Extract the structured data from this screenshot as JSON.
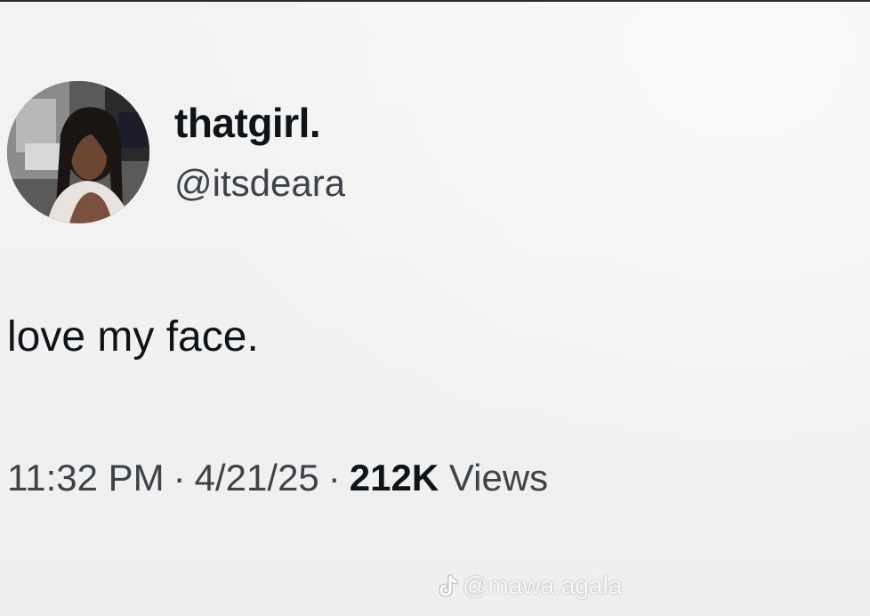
{
  "tweet": {
    "display_name": "thatgirl.",
    "handle": "@itsdeara",
    "text": "love my face.",
    "time": "11:32 PM",
    "date": "4/21/25",
    "separator": "·",
    "view_count": "212K",
    "views_label": "Views"
  },
  "watermark": {
    "icon": "tiktok-icon",
    "handle": "@mawa.agala"
  },
  "colors": {
    "background": "#f1f1f1",
    "primary_text": "#0f1419",
    "secondary_text": "#3d4348",
    "watermark": "#ffffff"
  }
}
